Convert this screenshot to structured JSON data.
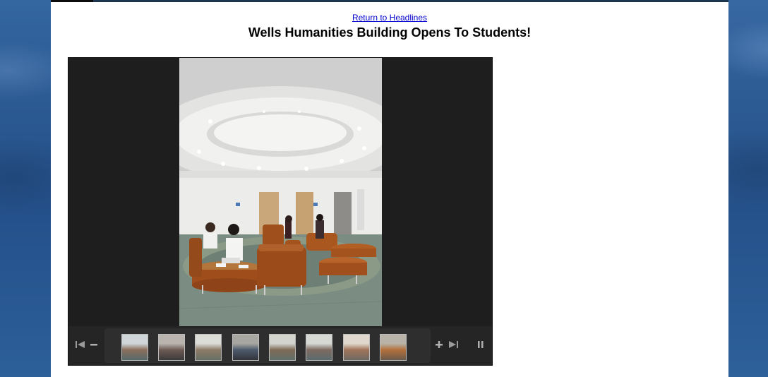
{
  "header": {
    "return_link": "Return to Headlines",
    "title": "Wells Humanities Building Opens To Students!"
  },
  "viewer": {
    "photo_alt": "Students seated on orange lounge chairs in a round atrium",
    "controls": {
      "first_icon": "skip-to-start-icon",
      "zoom_out_icon": "minus-icon",
      "zoom_in_icon": "plus-icon",
      "last_icon": "skip-to-end-icon",
      "pause_icon": "pause-icon"
    },
    "thumbnails": [
      {
        "colors": [
          "#cfd6d8",
          "#8a6e5c",
          "#556a6a"
        ]
      },
      {
        "colors": [
          "#b9b4ae",
          "#6e5b55",
          "#3c3a3c"
        ]
      },
      {
        "colors": [
          "#dcdcd6",
          "#8d7b67",
          "#667066"
        ]
      },
      {
        "colors": [
          "#a9a7a1",
          "#4d5a6c",
          "#33343a"
        ]
      },
      {
        "colors": [
          "#d3d4ce",
          "#7f6a56",
          "#60706c"
        ]
      },
      {
        "colors": [
          "#d6d8d4",
          "#7c6a60",
          "#5b6b6f"
        ]
      },
      {
        "colors": [
          "#e0d8cc",
          "#a0745a",
          "#6d6a63"
        ]
      },
      {
        "colors": [
          "#b8b2a8",
          "#b4703c",
          "#6a5a4a"
        ]
      }
    ]
  },
  "colors": {
    "link": "#0000cc",
    "background": "#2b5a8f",
    "viewer_bg": "#1e1e1e",
    "chair_orange": "#a4531f"
  }
}
